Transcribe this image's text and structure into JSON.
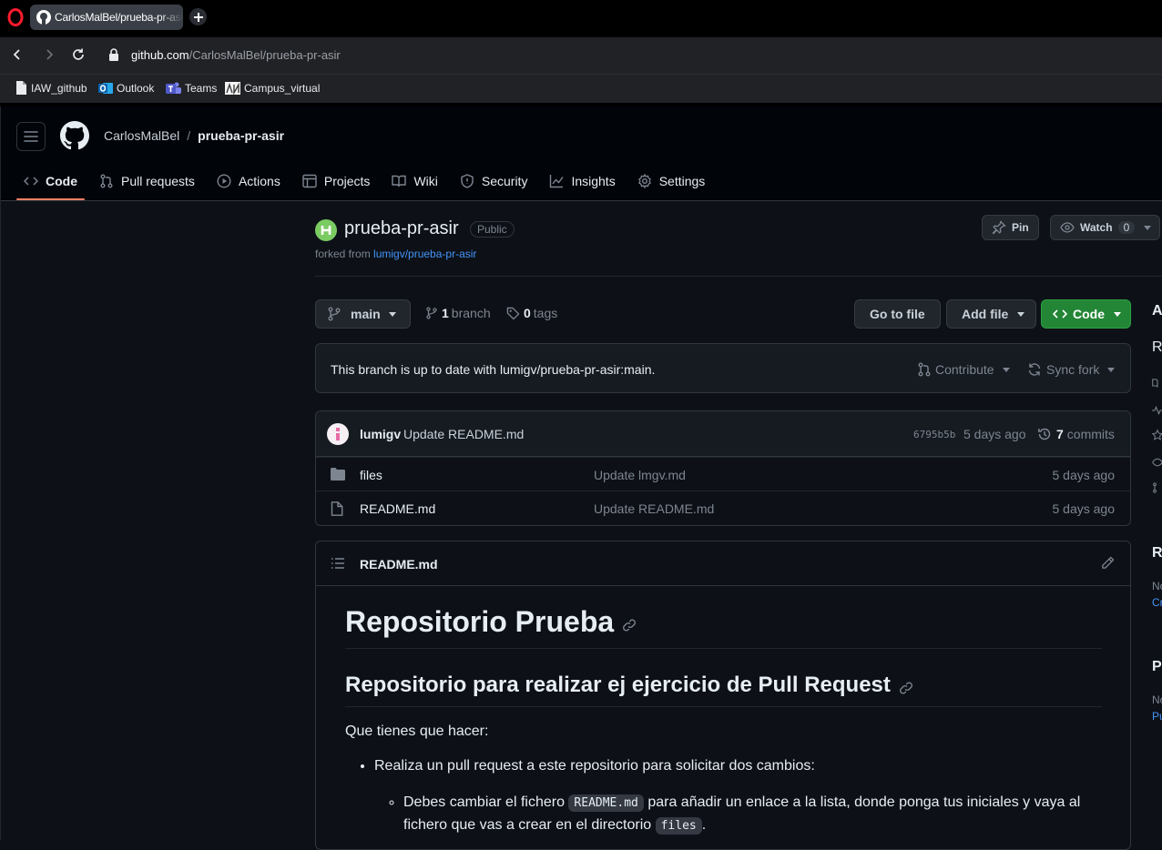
{
  "browser": {
    "tab_title": "CarlosMalBel/prueba-pr-asir",
    "url_host": "github.com",
    "url_path": "/CarlosMalBel/prueba-pr-asir",
    "bookmarks": [
      {
        "label": "IAW_github",
        "icon": "page-icon"
      },
      {
        "label": "Outlook",
        "icon": "outlook-icon"
      },
      {
        "label": "Teams",
        "icon": "teams-icon"
      },
      {
        "label": "Campus_virtual",
        "icon": "campus-icon"
      }
    ]
  },
  "header": {
    "owner": "CarlosMalBel",
    "separator": "/",
    "repo": "prueba-pr-asir",
    "tabs": [
      {
        "label": "Code",
        "icon": "code-icon",
        "active": true
      },
      {
        "label": "Pull requests",
        "icon": "pull-request-icon"
      },
      {
        "label": "Actions",
        "icon": "play-icon"
      },
      {
        "label": "Projects",
        "icon": "table-icon"
      },
      {
        "label": "Wiki",
        "icon": "book-icon"
      },
      {
        "label": "Security",
        "icon": "shield-icon"
      },
      {
        "label": "Insights",
        "icon": "graph-icon"
      },
      {
        "label": "Settings",
        "icon": "gear-icon"
      }
    ]
  },
  "repo": {
    "name": "prueba-pr-asir",
    "visibility": "Public",
    "forked_prefix": "forked from ",
    "forked_from": "lumigv/prueba-pr-asir",
    "pin_label": "Pin",
    "watch_label": "Watch",
    "watch_count": "0"
  },
  "branchbar": {
    "branch": "main",
    "branch_count": "1",
    "branch_word": "branch",
    "tag_count": "0",
    "tag_word": "tags",
    "go_to_file": "Go to file",
    "add_file": "Add file",
    "code": "Code"
  },
  "status": {
    "message": "This branch is up to date with lumigv/prueba-pr-asir:main.",
    "contribute": "Contribute",
    "sync_fork": "Sync fork"
  },
  "commit": {
    "author": "lumigv",
    "message": "Update README.md",
    "sha": "6795b5b",
    "date": "5 days ago",
    "count": "7",
    "count_word": "commits"
  },
  "files": [
    {
      "name": "files",
      "type": "folder",
      "commit": "Update lmgv.md",
      "date": "5 days ago"
    },
    {
      "name": "README.md",
      "type": "file",
      "commit": "Update README.md",
      "date": "5 days ago"
    }
  ],
  "readme": {
    "title": "README.md",
    "h1": "Repositorio Prueba",
    "h2": "Repositorio para realizar ej ejercicio de Pull Request",
    "intro": "Que tienes que hacer:",
    "bullet1": "Realiza un pull request a este repositorio para solicitar dos cambios:",
    "sub1_a": "Debes cambiar el fichero ",
    "sub1_code1": "README.md",
    "sub1_b": " para añadir un enlace a la lista, donde ponga tus iniciales y vaya al fichero que vas a crear en el directorio ",
    "sub1_code2": "files",
    "sub1_c": "."
  },
  "sidebar_clipped": {
    "about_initial": "A",
    "desc_initial": "Re",
    "releases_initial": "Re",
    "releases_text": "No",
    "releases_link": "Cr",
    "packages_initial": "Pa",
    "packages_text": "No",
    "packages_link": "Pu"
  }
}
